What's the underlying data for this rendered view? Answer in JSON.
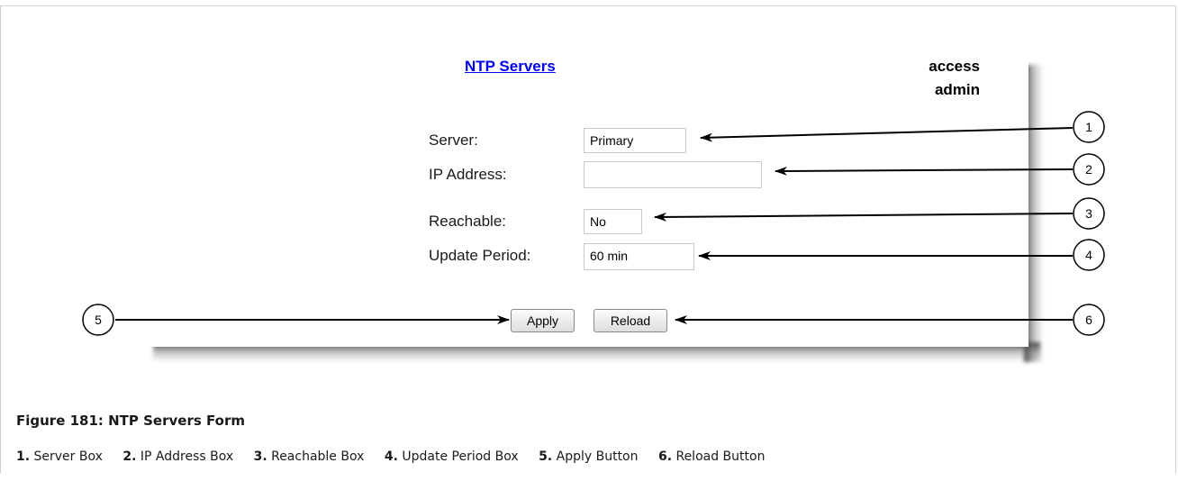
{
  "form": {
    "title": "NTP Servers",
    "access_line1": "access",
    "access_line2": "admin",
    "fields": {
      "server": {
        "label": "Server:",
        "value": "Primary"
      },
      "ip_address": {
        "label": "IP Address:",
        "value": ""
      },
      "reachable": {
        "label": "Reachable:",
        "value": "No"
      },
      "update_period": {
        "label": "Update Period:",
        "value": "60 min"
      }
    },
    "buttons": {
      "apply": "Apply",
      "reload": "Reload"
    }
  },
  "callouts": [
    "1",
    "2",
    "3",
    "4",
    "5",
    "6"
  ],
  "caption": {
    "title": "Figure 181: NTP Servers Form",
    "items": [
      {
        "num": "1.",
        "label": "Server Box"
      },
      {
        "num": "2.",
        "label": "IP Address Box"
      },
      {
        "num": "3.",
        "label": "Reachable Box"
      },
      {
        "num": "4.",
        "label": "Update Period Box"
      },
      {
        "num": "5.",
        "label": "Apply Button"
      },
      {
        "num": "6.",
        "label": "Reload Button"
      }
    ]
  }
}
